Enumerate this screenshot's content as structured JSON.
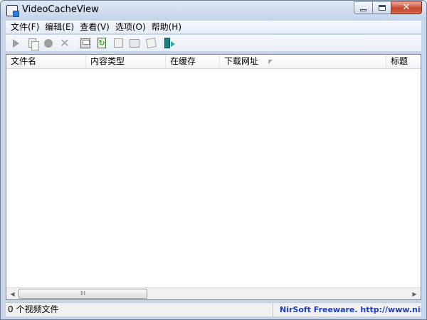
{
  "window": {
    "title": "VideoCacheView",
    "app_icon": "videocacheview-app-icon",
    "close_glyph": "✕"
  },
  "menubar": {
    "items": [
      {
        "label": "文件(F)"
      },
      {
        "label": "编辑(E)"
      },
      {
        "label": "查看(V)"
      },
      {
        "label": "选项(O)"
      },
      {
        "label": "帮助(H)"
      }
    ]
  },
  "toolbar": {
    "buttons": [
      {
        "icon": "play-icon",
        "enabled": false
      },
      {
        "icon": "copy-files-icon",
        "enabled": false
      },
      {
        "icon": "stop-icon",
        "enabled": false
      },
      {
        "icon": "delete-icon",
        "enabled": false
      },
      {
        "icon": "save-icon",
        "enabled": true
      },
      {
        "icon": "refresh-icon",
        "enabled": true
      },
      {
        "icon": "html-report-icon",
        "enabled": false
      },
      {
        "icon": "properties-icon",
        "enabled": false
      },
      {
        "icon": "find-icon",
        "enabled": false
      },
      {
        "icon": "exit-icon",
        "enabled": true
      }
    ]
  },
  "list": {
    "columns": [
      {
        "label": "文件名"
      },
      {
        "label": "内容类型"
      },
      {
        "label": "在缓存"
      },
      {
        "label": "下载网址",
        "sorted": true
      },
      {
        "label": "标题"
      }
    ],
    "rows": [],
    "scroll_thumb_label": "III"
  },
  "statusbar": {
    "count_text": "0 个视频文件",
    "link_text": "NirSoft Freeware.  http://www.nirsoft.ne"
  },
  "colors": {
    "status_link": "#1a3ccc",
    "close_button": "#c6452c"
  }
}
